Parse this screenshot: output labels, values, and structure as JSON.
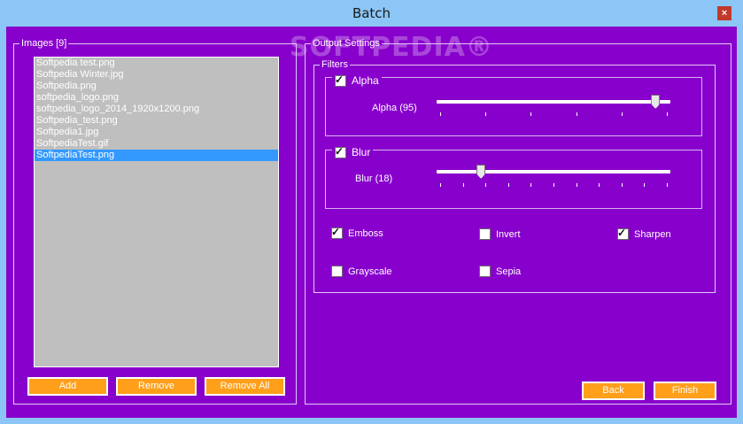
{
  "window": {
    "title": "Batch",
    "close_glyph": "×"
  },
  "watermark": "SOFTPEDIA®",
  "images": {
    "legend": "Images [9]",
    "files": [
      "Softpedia test.png",
      "Softpedia Winter.jpg",
      "Softpedia.png",
      "softpedia_logo.png",
      "softpedia_logo_2014_1920x1200.png",
      "Softpedia_test.png",
      "Softpedia1.jpg",
      "SoftpediaTest.gif",
      "SoftpediaTest.png"
    ],
    "selected_index": 8,
    "add_label": "Add",
    "remove_label": "Remove",
    "remove_all_label": "Remove All"
  },
  "output": {
    "legend": "Output Settings",
    "filters_legend": "Filters",
    "alpha": {
      "label": "Alpha",
      "checked": true,
      "slider_label": "Alpha (95)",
      "value": 95,
      "max": 100
    },
    "blur": {
      "label": "Blur",
      "checked": true,
      "slider_label": "Blur (18)",
      "value": 18,
      "max": 100
    },
    "checks": {
      "emboss": {
        "label": "Emboss",
        "checked": true
      },
      "invert": {
        "label": "Invert",
        "checked": false
      },
      "sharpen": {
        "label": "Sharpen",
        "checked": true
      },
      "grayscale": {
        "label": "Grayscale",
        "checked": false
      },
      "sepia": {
        "label": "Sepia",
        "checked": false
      }
    },
    "check_glyph": "✓"
  },
  "footer": {
    "back_label": "Back",
    "finish_label": "Finish"
  }
}
